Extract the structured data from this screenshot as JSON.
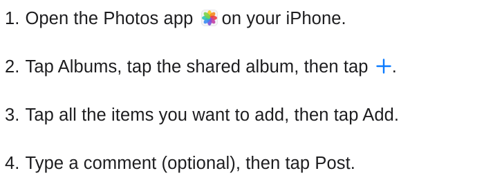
{
  "steps": [
    {
      "number": "1.",
      "before": "Open the Photos app",
      "icon": "photos-app-icon",
      "after": "on your iPhone."
    },
    {
      "number": "2.",
      "before": "Tap Albums, tap the shared album, then tap",
      "icon": "plus-icon",
      "after": "."
    },
    {
      "number": "3.",
      "text": "Tap all the items you want to add, then tap Add."
    },
    {
      "number": "4.",
      "text": "Type a comment (optional), then tap Post."
    }
  ],
  "colors": {
    "text": "#1d1d1f",
    "accent": "#0a7aff"
  }
}
